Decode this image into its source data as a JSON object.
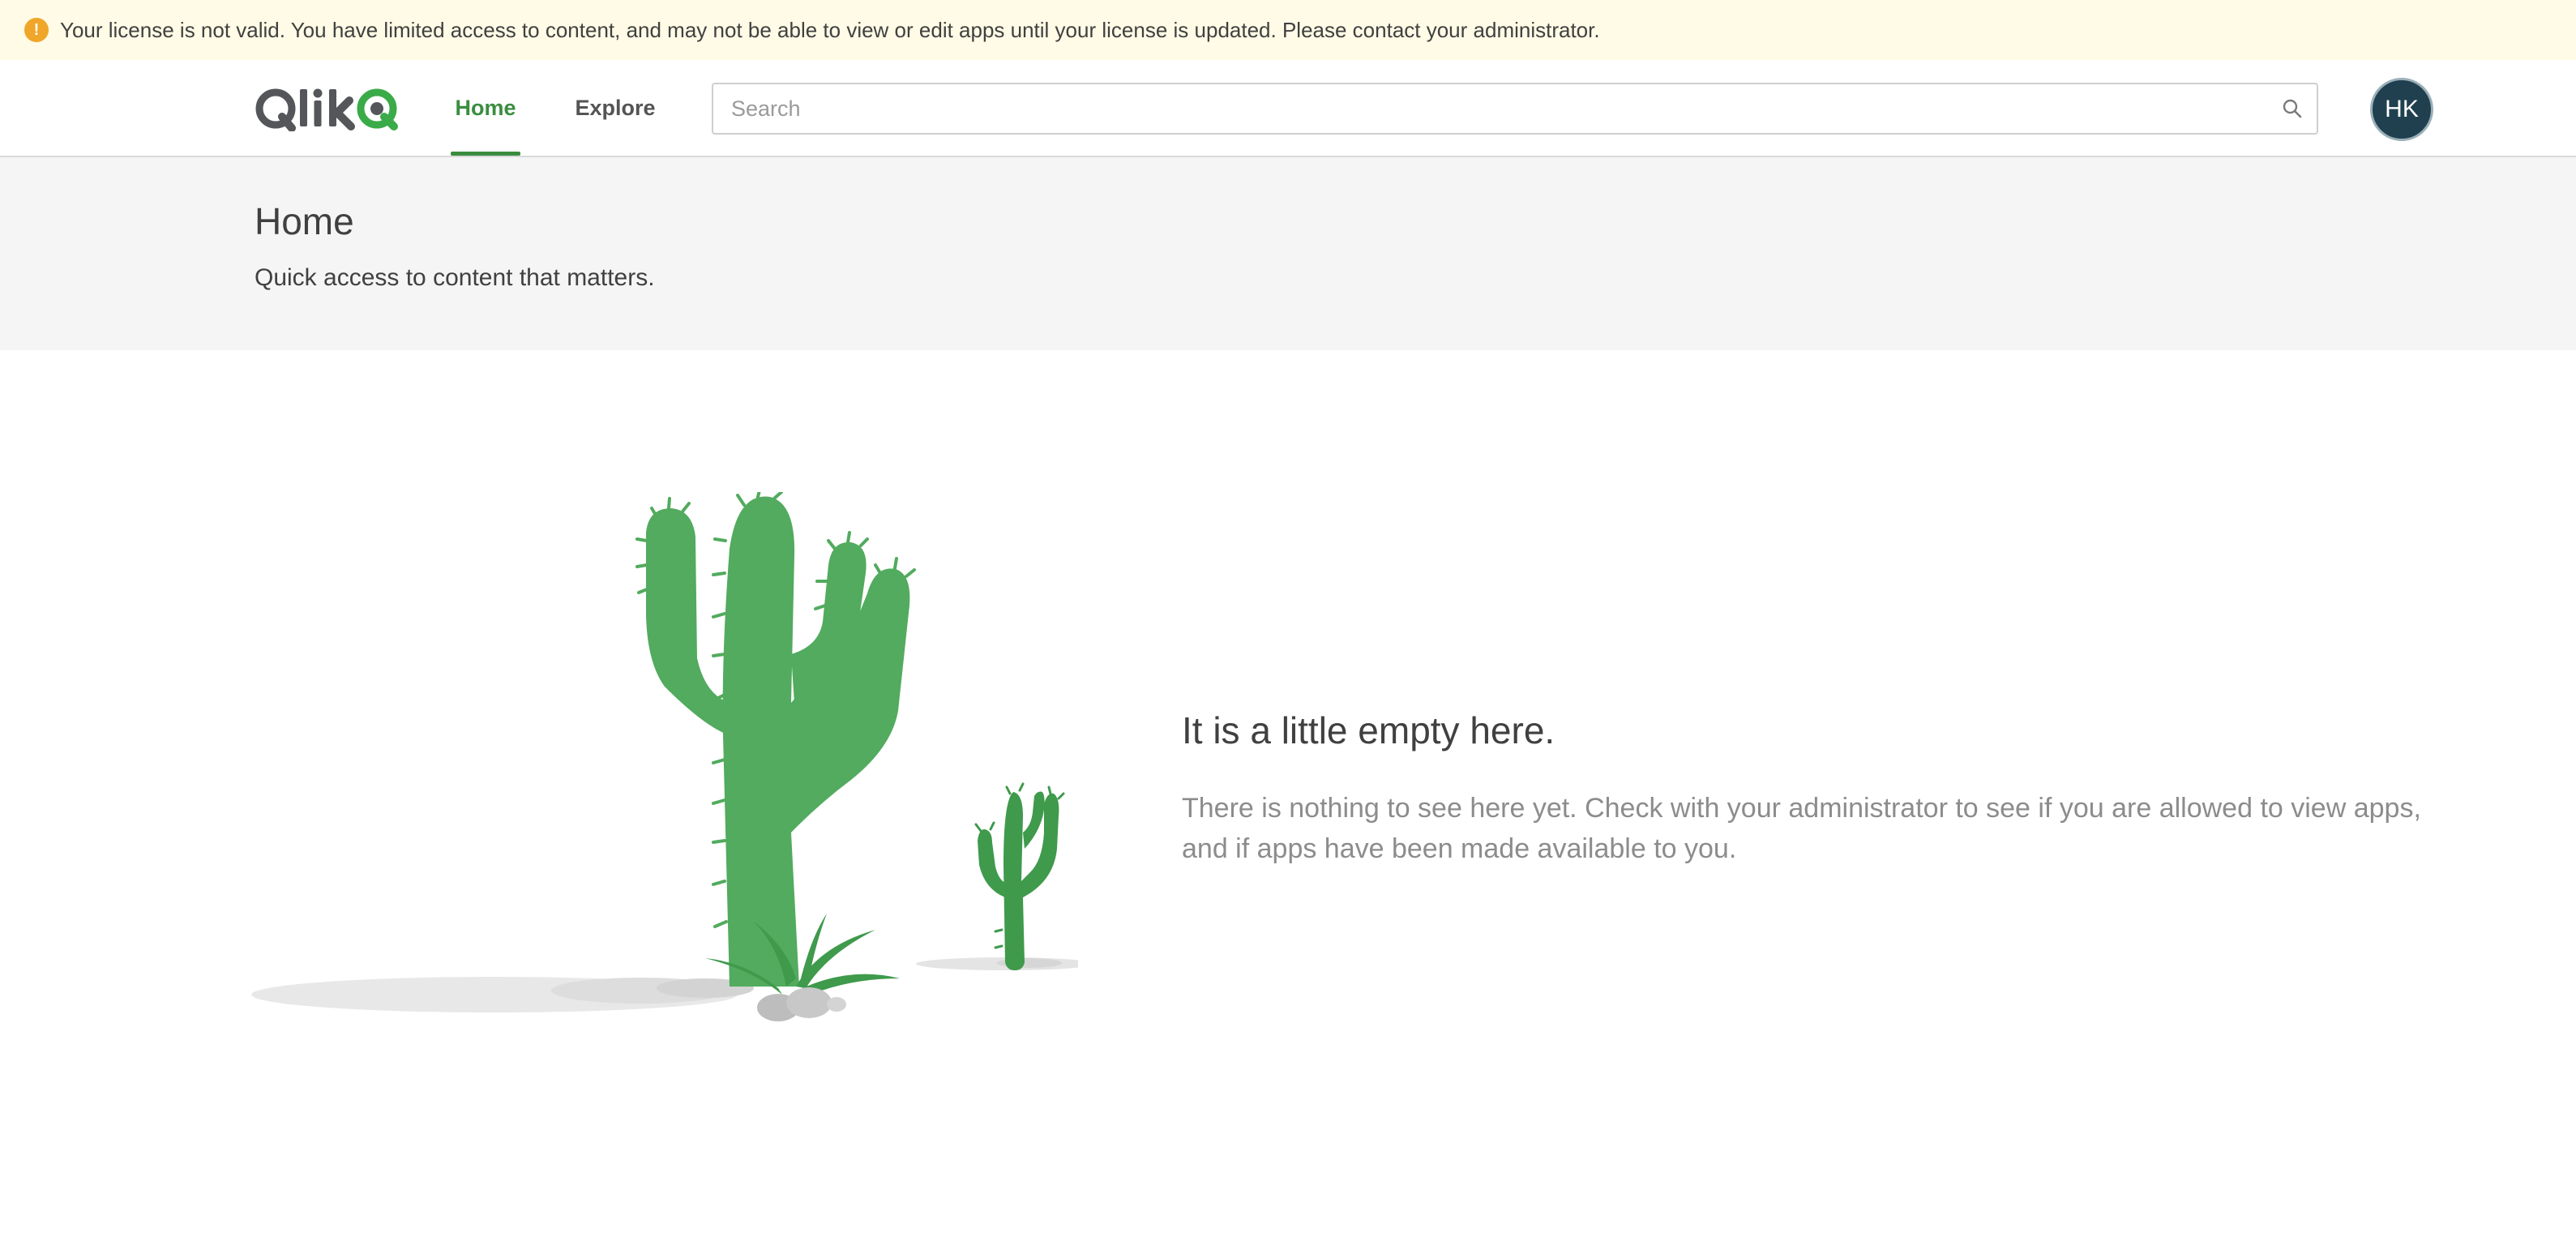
{
  "banner": {
    "message": "Your license is not valid. You have limited access to content, and may not be able to view or edit apps until your license is updated. Please contact your administrator.",
    "icon": "warning-icon",
    "icon_glyph": "!",
    "color": "#f0a629"
  },
  "header": {
    "logo_text": "Qlik",
    "tabs": [
      {
        "label": "Home",
        "active": true
      },
      {
        "label": "Explore",
        "active": false
      }
    ],
    "search": {
      "placeholder": "Search",
      "value": ""
    },
    "avatar_initials": "HK"
  },
  "hero": {
    "title": "Home",
    "subtitle": "Quick access to content that matters."
  },
  "empty_state": {
    "title": "It is a little empty here.",
    "body": "There is nothing to see here yet. Check with your administrator to see if you are allowed to view apps, and if apps have been made available to you."
  },
  "colors": {
    "accent": "#3a8d3f",
    "avatar_bg": "#20404f",
    "cactus": "#52ab5e",
    "cactus_dark": "#3f9a4c"
  }
}
